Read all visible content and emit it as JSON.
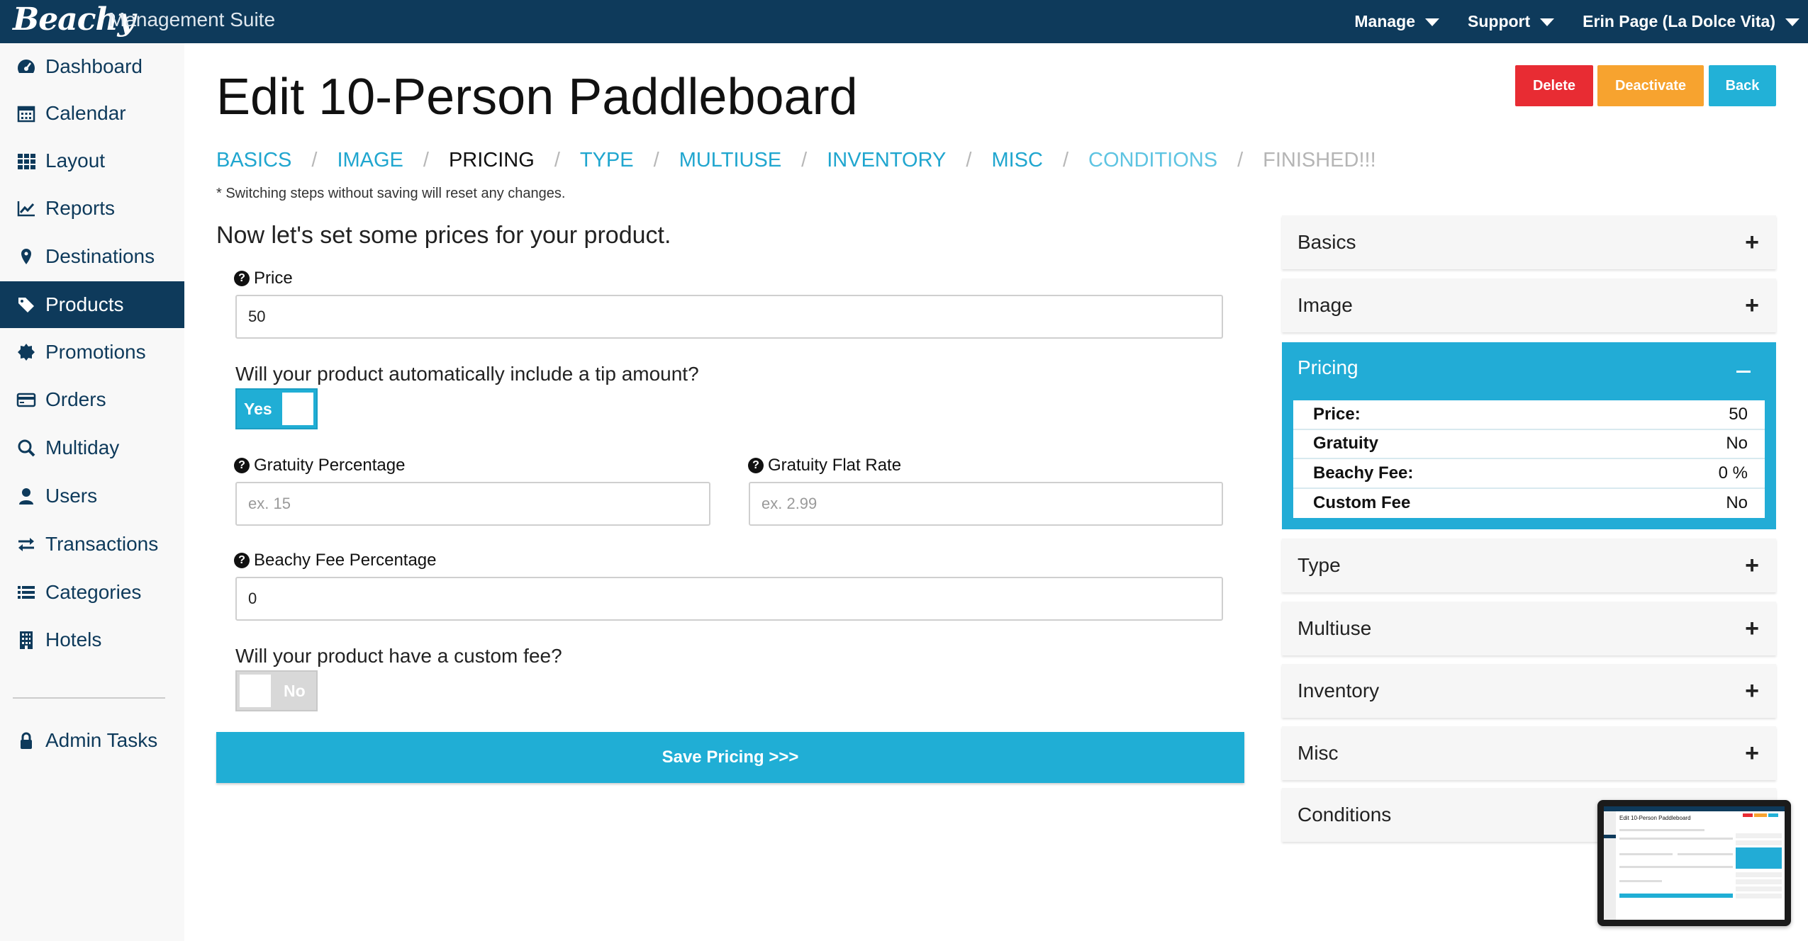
{
  "header": {
    "logo": "Beachy",
    "suite": "Management Suite",
    "nav": [
      {
        "label": "Manage"
      },
      {
        "label": "Support"
      },
      {
        "label": "Erin Page (La Dolce Vita)"
      }
    ]
  },
  "sidebar": {
    "items": [
      {
        "label": "Dashboard",
        "icon": "dashboard-icon"
      },
      {
        "label": "Calendar",
        "icon": "calendar-icon"
      },
      {
        "label": "Layout",
        "icon": "grid-icon"
      },
      {
        "label": "Reports",
        "icon": "line-chart-icon"
      },
      {
        "label": "Destinations",
        "icon": "map-pin-icon"
      },
      {
        "label": "Products",
        "icon": "tag-icon",
        "active": true
      },
      {
        "label": "Promotions",
        "icon": "badge-icon"
      },
      {
        "label": "Orders",
        "icon": "credit-card-icon"
      },
      {
        "label": "Multiday",
        "icon": "search-icon"
      },
      {
        "label": "Users",
        "icon": "user-icon"
      },
      {
        "label": "Transactions",
        "icon": "exchange-icon"
      },
      {
        "label": "Categories",
        "icon": "list-icon"
      },
      {
        "label": "Hotels",
        "icon": "building-icon"
      }
    ],
    "admin": {
      "label": "Admin Tasks",
      "icon": "lock-icon"
    }
  },
  "page": {
    "title": "Edit 10-Person Paddleboard",
    "buttons": {
      "delete": "Delete",
      "deactivate": "Deactivate",
      "back": "Back"
    },
    "steps": [
      {
        "label": "BASICS",
        "state": "link"
      },
      {
        "label": "IMAGE",
        "state": "link"
      },
      {
        "label": "PRICING",
        "state": "current"
      },
      {
        "label": "TYPE",
        "state": "link"
      },
      {
        "label": "MULTIUSE",
        "state": "link"
      },
      {
        "label": "INVENTORY",
        "state": "link"
      },
      {
        "label": "MISC",
        "state": "link"
      },
      {
        "label": "CONDITIONS",
        "state": "link-light"
      },
      {
        "label": "FINISHED!!!",
        "state": "disabled"
      }
    ],
    "step_separator": "/",
    "steps_note": "* Switching steps without saving will reset any changes."
  },
  "form": {
    "heading": "Now let's set some prices for your product.",
    "price": {
      "label": "Price",
      "value": "50"
    },
    "tip_question": "Will your product automatically include a tip amount?",
    "tip_toggle": {
      "label": "Yes",
      "on": true
    },
    "gratuity_percentage": {
      "label": "Gratuity Percentage",
      "placeholder": "ex. 15"
    },
    "gratuity_flat_rate": {
      "label": "Gratuity Flat Rate",
      "placeholder": "ex. 2.99"
    },
    "beachy_fee": {
      "label": "Beachy Fee Percentage",
      "value": "0"
    },
    "custom_fee_question": "Will your product have a custom fee?",
    "custom_fee_toggle": {
      "label": "No",
      "on": false
    },
    "save_label": "Save Pricing >>>"
  },
  "accordion": {
    "items": [
      "Basics",
      "Image",
      "Pricing",
      "Type",
      "Multiuse",
      "Inventory",
      "Misc",
      "Conditions"
    ],
    "expand_symbol": "+",
    "pricing_summary": [
      {
        "key": "Price:",
        "value": "50"
      },
      {
        "key": "Gratuity",
        "value": "No"
      },
      {
        "key": "Beachy Fee:",
        "value": "0 %"
      },
      {
        "key": "Custom Fee",
        "value": "No"
      }
    ]
  },
  "thumbnail": {
    "title": "Edit 10-Person Paddleboard"
  },
  "colors": {
    "navy": "#0e3a5b",
    "accent": "#20aed5",
    "delete": "#e82c33",
    "deactivate": "#f7a32f"
  }
}
